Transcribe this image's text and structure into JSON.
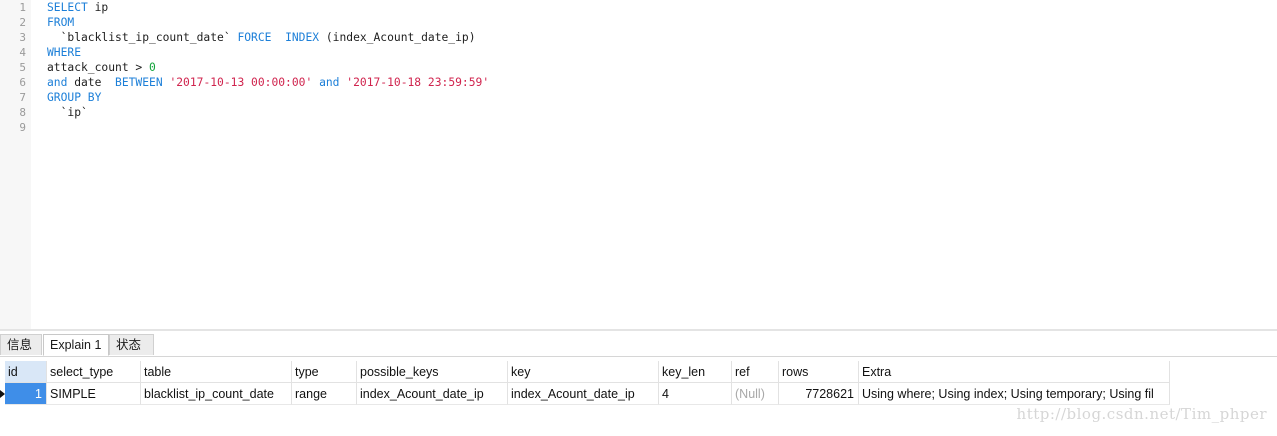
{
  "editor": {
    "line_numbers": [
      "1",
      "2",
      "3",
      "4",
      "5",
      "6",
      "7",
      "8",
      "9"
    ],
    "lines": [
      [
        {
          "t": "SELECT",
          "c": "kw"
        },
        {
          "t": " ip",
          "c": ""
        }
      ],
      [
        {
          "t": "FROM",
          "c": "kw"
        }
      ],
      [
        {
          "t": "  `blacklist_ip_count_date` ",
          "c": ""
        },
        {
          "t": "FORCE",
          "c": "kw"
        },
        {
          "t": "  ",
          "c": ""
        },
        {
          "t": "INDEX",
          "c": "kw"
        },
        {
          "t": " (index_Acount_date_ip)",
          "c": ""
        }
      ],
      [
        {
          "t": "WHERE",
          "c": "kw"
        }
      ],
      [
        {
          "t": "attack_count > ",
          "c": ""
        },
        {
          "t": "0",
          "c": "num"
        }
      ],
      [
        {
          "t": "and",
          "c": "kw"
        },
        {
          "t": " date  ",
          "c": ""
        },
        {
          "t": "BETWEEN",
          "c": "kw"
        },
        {
          "t": " ",
          "c": ""
        },
        {
          "t": "'2017-10-13 00:00:00'",
          "c": "str"
        },
        {
          "t": " ",
          "c": ""
        },
        {
          "t": "and",
          "c": "kw"
        },
        {
          "t": " ",
          "c": ""
        },
        {
          "t": "'2017-10-18 23:59:59'",
          "c": "str"
        }
      ],
      [
        {
          "t": "GROUP BY",
          "c": "kw"
        }
      ],
      [
        {
          "t": "  `ip`",
          "c": ""
        }
      ],
      []
    ]
  },
  "tabs": [
    "信息",
    "Explain 1",
    "状态"
  ],
  "active_tab": "Explain 1",
  "result": {
    "columns": [
      "id",
      "select_type",
      "table",
      "type",
      "possible_keys",
      "key",
      "key_len",
      "ref",
      "rows",
      "Extra"
    ],
    "rows": [
      [
        "1",
        "SIMPLE",
        "blacklist_ip_count_date",
        "range",
        "index_Acount_date_ip",
        "index_Acount_date_ip",
        "4",
        "(Null)",
        "7728621",
        "Using where; Using index; Using temporary; Using fil"
      ]
    ]
  },
  "watermark": "http://blog.csdn.net/Tim_phper",
  "colors": {
    "keyword": "#1c7fd8",
    "string": "#d0244e",
    "number": "#11a33a",
    "selection": "#3f8ee8"
  }
}
